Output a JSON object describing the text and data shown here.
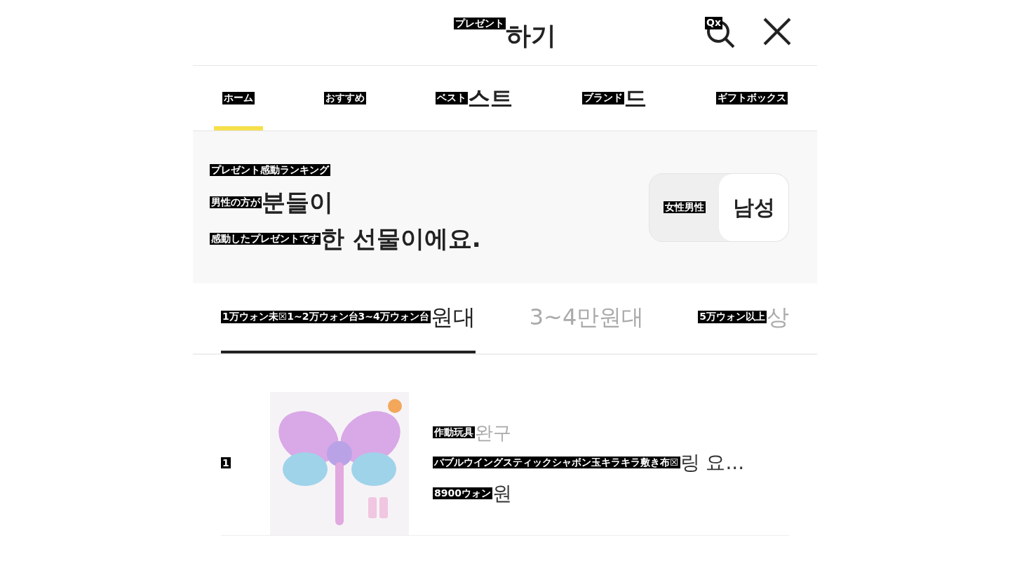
{
  "header": {
    "title": {
      "overlay": "プレゼント",
      "text": "하기"
    },
    "search_overlay": "Qx"
  },
  "tabs": [
    {
      "overlay": "ホーム",
      "selected": true
    },
    {
      "overlay": "おすすめ",
      "selected": false
    },
    {
      "overlay": "ベスト",
      "text": "스트",
      "selected": false
    },
    {
      "overlay": "ブランド",
      "text": "드",
      "selected": false
    },
    {
      "overlay": "ギフトボックス",
      "selected": false
    }
  ],
  "ranking": {
    "label": "プレゼント感動ランキング",
    "lines": [
      {
        "overlay": "男性の方が",
        "text": "분들이"
      },
      {
        "overlay": "感動したプレゼントです",
        "text": "한 선물이에요."
      }
    ],
    "toggle": [
      {
        "overlay": "女性男性",
        "selected": false
      },
      {
        "text": "남성",
        "selected": true
      }
    ]
  },
  "price_tabs": [
    {
      "overlay": "1万ウォン未☒1~2万ウォン台3~4万ウォン台",
      "text": "원대",
      "selected": true
    },
    {
      "text": "3~4만원대",
      "selected": false
    },
    {
      "overlay": "5万ウォン以上",
      "text": "상",
      "selected": false
    }
  ],
  "products": [
    {
      "rank": "1",
      "kind": "picture",
      "category": {
        "overlay": "作動玩具",
        "text": "완구"
      },
      "name": {
        "overlay": "バブルウイングスティックシャボン玉キラキラ敷き布☒",
        "text": "링 요..."
      },
      "price": {
        "overlay": "8900ウォン",
        "text": "원"
      }
    }
  ]
}
